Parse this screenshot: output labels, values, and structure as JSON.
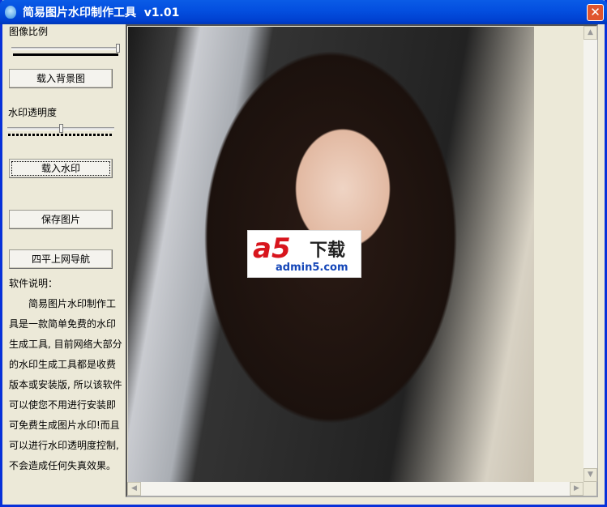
{
  "window": {
    "title": "简易图片水印制作工具  v1.01",
    "close_label": "✕"
  },
  "sidebar": {
    "scale_label": "图像比例",
    "scale_value": 1.0,
    "load_bg_button": "载入背景图",
    "opacity_label": "水印透明度",
    "opacity_value": 0.5,
    "load_watermark_button": "载入水印",
    "save_button": "保存图片",
    "nav_button": "四平上网导航",
    "desc_title": "软件说明：",
    "desc_text": "　　简易图片水印制作工具是一款简单免费的水印生成工具, 目前网络大部分的水印生成工具都是收费版本或安装版, 所以该软件可以使您不用进行安装即可免费生成图片水印!而且可以进行水印透明度控制, 不会造成任何失真效果。"
  },
  "watermark": {
    "logo": "a5",
    "logo_text": "下载",
    "domain": "admin5.com"
  },
  "scroll": {
    "up": "▲",
    "down": "▼",
    "left": "◀",
    "right": "▶"
  }
}
